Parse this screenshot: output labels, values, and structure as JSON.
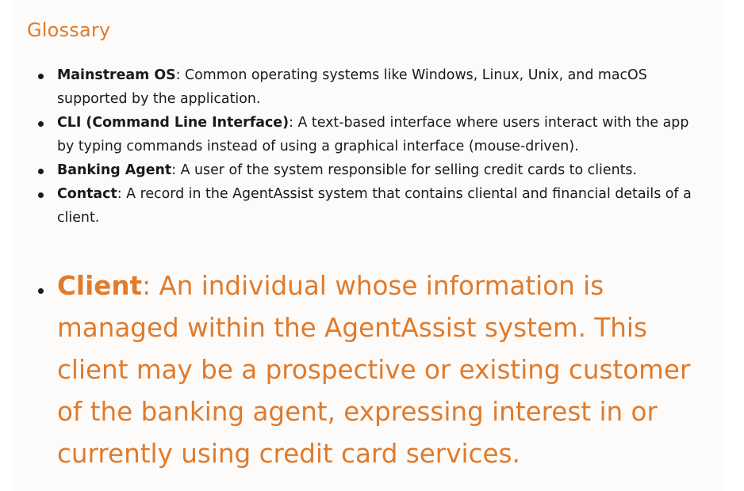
{
  "glossary": {
    "title": "Glossary",
    "items": [
      {
        "term": "Mainstream OS",
        "definition": ": Common operating systems like Windows, Linux, Unix, and macOS supported by the application."
      },
      {
        "term": "CLI (Command Line Interface)",
        "definition": ": A text-based interface where users interact with the app by typing commands instead of using a graphical interface (mouse-driven)."
      },
      {
        "term": "Banking Agent",
        "definition": ": A user of the system responsible for selling credit cards to clients."
      },
      {
        "term": "Contact",
        "definition": ": A record in the AgentAssist system that contains cliental and financial details of a client."
      }
    ],
    "highlight": {
      "term": "Client",
      "definition": ": An individual whose information is managed within the AgentAssist system. This client may be a prospective or existing customer of the banking agent, expressing interest in or currently using credit card services."
    }
  },
  "colors": {
    "accent": "#e07b2c",
    "text": "#1a1a1a",
    "background": "#fcfbfa"
  }
}
